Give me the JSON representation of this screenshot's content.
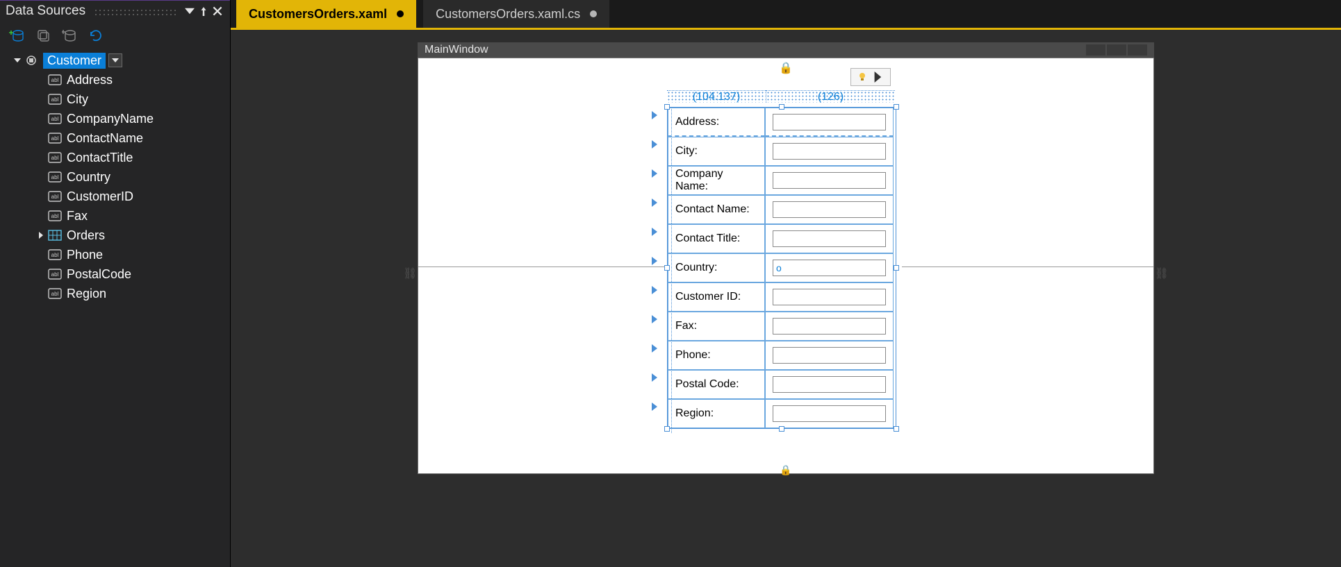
{
  "panel": {
    "title": "Data Sources"
  },
  "tree": {
    "root": {
      "label": "Customer"
    },
    "items": [
      {
        "label": "Address",
        "kind": "abc"
      },
      {
        "label": "City",
        "kind": "abc"
      },
      {
        "label": "CompanyName",
        "kind": "abc"
      },
      {
        "label": "ContactName",
        "kind": "abc"
      },
      {
        "label": "ContactTitle",
        "kind": "abc"
      },
      {
        "label": "Country",
        "kind": "abc"
      },
      {
        "label": "CustomerID",
        "kind": "abc"
      },
      {
        "label": "Fax",
        "kind": "abc"
      },
      {
        "label": "Orders",
        "kind": "grid",
        "expandable": true
      },
      {
        "label": "Phone",
        "kind": "abc"
      },
      {
        "label": "PostalCode",
        "kind": "abc"
      },
      {
        "label": "Region",
        "kind": "abc"
      }
    ]
  },
  "tabs": [
    {
      "label": "CustomersOrders.xaml",
      "active": true,
      "dirty": true
    },
    {
      "label": "CustomersOrders.xaml.cs",
      "active": false,
      "dirty": true
    }
  ],
  "designer": {
    "window_title": "MainWindow",
    "ruler": {
      "col_a": "(104.137)",
      "col_b": "(126)"
    },
    "form_rows": [
      {
        "label": "Address:",
        "value": ""
      },
      {
        "label": "City:",
        "value": ""
      },
      {
        "label": "Company Name:",
        "value": ""
      },
      {
        "label": "Contact Name:",
        "value": ""
      },
      {
        "label": "Contact Title:",
        "value": ""
      },
      {
        "label": "Country:",
        "value": "o",
        "highlight": true
      },
      {
        "label": "Customer ID:",
        "value": ""
      },
      {
        "label": "Fax:",
        "value": ""
      },
      {
        "label": "Phone:",
        "value": ""
      },
      {
        "label": "Postal Code:",
        "value": ""
      },
      {
        "label": "Region:",
        "value": ""
      }
    ]
  }
}
